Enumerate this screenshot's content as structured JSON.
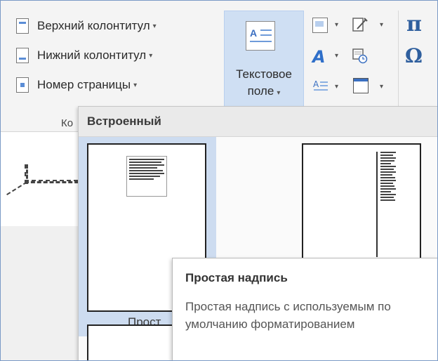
{
  "ribbon": {
    "header_footer": {
      "header_label": "Верхний колонтитул",
      "footer_label": "Нижний колонтитул",
      "page_number_label": "Номер страницы",
      "group_label_partial": "Ко"
    },
    "textbox_button": {
      "label_line1": "Текстовое",
      "label_line2": "поле"
    },
    "symbols": {
      "equation": "π",
      "symbol": "Ω"
    }
  },
  "gallery": {
    "section_header": "Встроенный",
    "selected_item_caption_partial": "Прост"
  },
  "tooltip": {
    "title": "Простая надпись",
    "description": "Простая надпись с используемым по умолчанию форматированием"
  },
  "colors": {
    "selection": "#cddcf0",
    "accent": "#2f5f9e"
  }
}
